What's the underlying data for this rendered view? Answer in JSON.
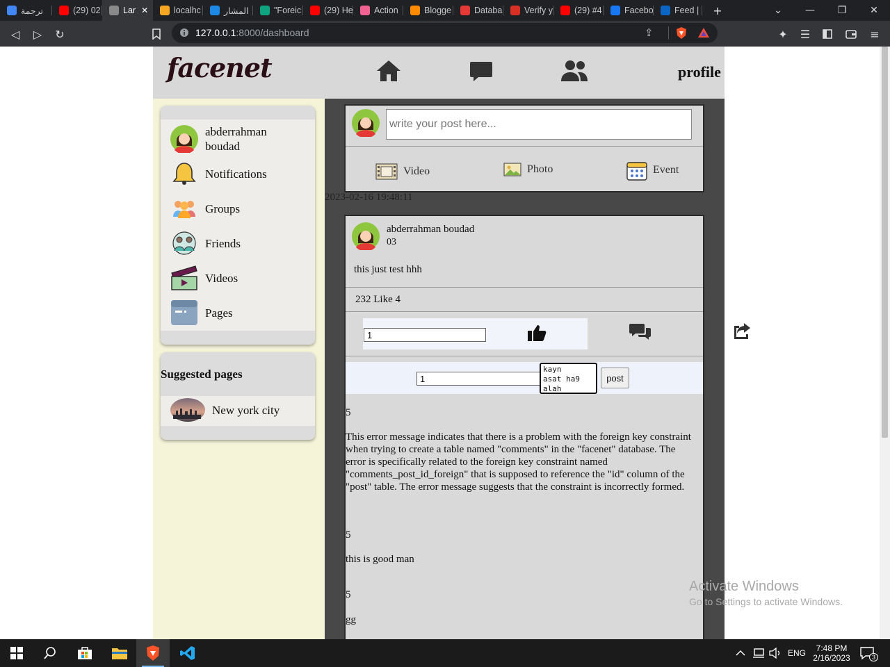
{
  "browser": {
    "tabs": [
      {
        "label": "ترجمة",
        "color": "#4285f4",
        "active": false
      },
      {
        "label": "(29) 02",
        "color": "#ff0000",
        "active": false
      },
      {
        "label": "Lar",
        "color": "#8a8a8a",
        "active": true
      },
      {
        "label": "localhc",
        "color": "#f6a623",
        "active": false
      },
      {
        "label": "المشار",
        "color": "#1e88e5",
        "active": false
      },
      {
        "label": "\"Foreic",
        "color": "#10a37f",
        "active": false
      },
      {
        "label": "(29) He",
        "color": "#ff0000",
        "active": false
      },
      {
        "label": "Action",
        "color": "#f06292",
        "active": false
      },
      {
        "label": "Blogge",
        "color": "#ff8c00",
        "active": false
      },
      {
        "label": "Databa",
        "color": "#e53935",
        "active": false
      },
      {
        "label": "Verify y",
        "color": "#d93025",
        "active": false
      },
      {
        "label": "(29) #4",
        "color": "#ff0000",
        "active": false
      },
      {
        "label": "Facebo",
        "color": "#1877f2",
        "active": false
      },
      {
        "label": "Feed |",
        "color": "#0a66c2",
        "active": false
      }
    ],
    "new_tab_label": "+",
    "url_host": "127.0.0.1",
    "url_path": ":8000/dashboard"
  },
  "header": {
    "logo": "facenet",
    "profile_label": "profile"
  },
  "sidebar": {
    "user_name": "abderrahman boudad",
    "items": [
      {
        "label": "Notifications",
        "icon": "bell-icon"
      },
      {
        "label": "Groups",
        "icon": "groups-icon"
      },
      {
        "label": "Friends",
        "icon": "friends-icon"
      },
      {
        "label": "Videos",
        "icon": "video-clapper-icon"
      },
      {
        "label": "Pages",
        "icon": "pages-icon"
      }
    ],
    "suggested_title": "Suggested pages",
    "suggested_pages": [
      {
        "label": "New york city"
      }
    ]
  },
  "composer": {
    "placeholder": "write your post here...",
    "options": [
      {
        "label": "Video",
        "icon": "film-icon"
      },
      {
        "label": "Photo",
        "icon": "photo-icon"
      },
      {
        "label": "Event",
        "icon": "calendar-icon"
      }
    ]
  },
  "feed": {
    "timestamp": "2023-02-16 19:48:11",
    "post": {
      "author": "abderrahman boudad",
      "number": "03",
      "text": "this just test hhh",
      "likes_line": "232 Like 4",
      "like_input_value": "1",
      "comment_id_value": "1",
      "comment_text_value": "kayn\nasat ha9\nalah",
      "comment_button": "post",
      "comments": [
        {
          "id": "5",
          "text": "This error message indicates that there is a problem with the foreign key constraint when trying to create a table named \"comments\" in the \"facenet\" database. The error is specifically related to the foreign key constraint named \"comments_post_id_foreign\" that is supposed to reference the \"id\" column of the \"post\" table. The error message suggests that the constraint is incorrectly formed."
        },
        {
          "id": "5",
          "text": "this is good man"
        },
        {
          "id": "5",
          "text": "gg"
        }
      ]
    }
  },
  "watermark": {
    "title": "Activate Windows",
    "subtitle": "Go to Settings to activate Windows."
  },
  "taskbar": {
    "language": "ENG",
    "time": "7:48 PM",
    "date": "2/16/2023",
    "notifications_count": "3"
  }
}
